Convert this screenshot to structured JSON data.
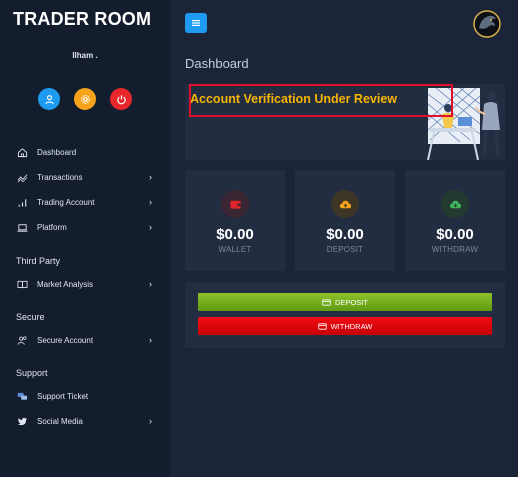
{
  "sidebar": {
    "brand": "TRADER ROOM",
    "username": "Ilham .",
    "quick_actions": [
      {
        "name": "profile",
        "icon": "user-icon",
        "color": "#1e9bf0"
      },
      {
        "name": "settings",
        "icon": "gear-icon",
        "color": "#f5a31a"
      },
      {
        "name": "logout",
        "icon": "power-icon",
        "color": "#e8262b"
      }
    ],
    "nav": {
      "dashboard": "Dashboard",
      "transactions": "Transactions",
      "trading_account": "Trading Account",
      "platform": "Platform",
      "third_party_heading": "Third Party",
      "market_analysis": "Market Analysis",
      "secure_heading": "Secure",
      "secure_account": "Secure Account",
      "support_heading": "Support",
      "support_ticket": "Support Ticket",
      "social_media": "Social Media"
    },
    "chevron": "›"
  },
  "main": {
    "title": "Dashboard",
    "banner_text": "Account Verification Under Review",
    "cards": {
      "wallet": {
        "amount": "$0.00",
        "caption": "WALLET",
        "icon": "wallet-icon",
        "color": "#e0242e"
      },
      "deposit": {
        "amount": "$0.00",
        "caption": "DEPOSIT",
        "icon": "cloud-upload-icon",
        "color": "#f5a31a"
      },
      "withdraw": {
        "amount": "$0.00",
        "caption": "WITHDRAW",
        "icon": "cloud-download-icon",
        "color": "#3fb65a"
      }
    },
    "buttons": {
      "deposit": "DEPOSIT",
      "withdraw": "WITHDRAW"
    }
  },
  "colors": {
    "sidebar_bg": "#141d2e",
    "main_bg": "#1c2537",
    "panel_bg": "#232d42",
    "accent_blue": "#1e9bf0",
    "banner_text": "#f7b500",
    "deposit_green": "#7ab520",
    "withdraw_red": "#e30b12"
  }
}
